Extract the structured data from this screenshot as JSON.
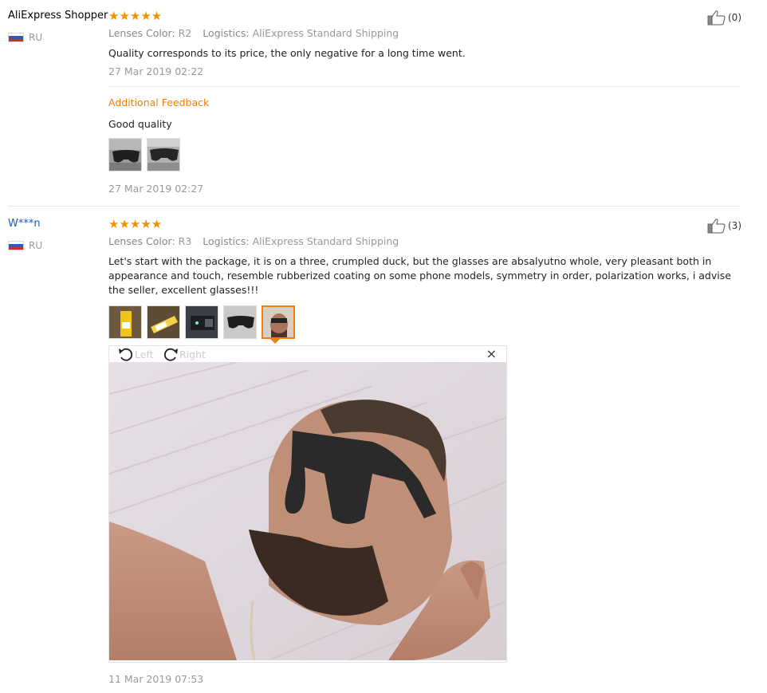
{
  "reviews": [
    {
      "user": "AliExpress Shopper",
      "country": "RU",
      "stars": "★★★★★",
      "lenses_label": "Lenses Color:",
      "lenses_value": "R2",
      "logistics_label": "Logistics:",
      "logistics_value": "AliExpress Standard Shipping",
      "text": "Quality corresponds to its price, the only negative for a long time went.",
      "date": "27 Mar 2019 02:22",
      "helpful_count": "(0)",
      "additional_label": "Additional Feedback",
      "additional_text": "Good quality",
      "additional_date": "27 Mar 2019 02:27",
      "additional_images": [
        "sunglasses-photo",
        "sunglasses-photo"
      ]
    },
    {
      "user": "W***n",
      "country": "RU",
      "stars": "★★★★★",
      "lenses_label": "Lenses Color:",
      "lenses_value": "R3",
      "logistics_label": "Logistics:",
      "logistics_value": "AliExpress Standard Shipping",
      "text": "Let's start with the package, it is on a three, crumpled duck, but the glasses are absalyutno whole, very pleasant both in appearance and touch, resemble rubberized coating on some phone models, symmetry in order, polarization works, i advise the seller, excellent glasses!!!",
      "date": "11 Mar 2019 07:53",
      "helpful_count": "(3)",
      "images": [
        "package-photo",
        "package-photo",
        "glasses-case-photo",
        "sunglasses-photo",
        "selfie-photo"
      ],
      "active_image": 4,
      "viewer": {
        "rotate_left": "Left",
        "rotate_right": "Right",
        "close": "×"
      }
    }
  ],
  "colors": {
    "star": "#f29100",
    "accent": "#f07e0a",
    "link": "#1a5bb5",
    "muted": "#999999"
  }
}
